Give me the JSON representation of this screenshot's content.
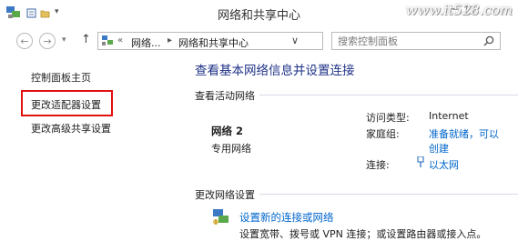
{
  "window": {
    "title": "网络和共享中心",
    "controls": [
      "─",
      "□"
    ],
    "watermark": "www.it528.com"
  },
  "navigation": {
    "breadcrumb_overflow": "«",
    "breadcrumbs": [
      "网络...",
      "网络和共享中心"
    ],
    "search_placeholder": "搜索控制面板"
  },
  "sidebar": {
    "items": [
      {
        "label": "控制面板主页"
      },
      {
        "label": "更改适配器设置",
        "highlighted": true
      },
      {
        "label": "更改高级共享设置"
      }
    ]
  },
  "main": {
    "title": "查看基本网络信息并设置连接",
    "active_networks_header": "查看活动网络",
    "network": {
      "name": "网络  2",
      "type": "专用网络"
    },
    "properties": {
      "access_type_label": "访问类型:",
      "access_type_value": "Internet",
      "homegroup_label": "家庭组:",
      "homegroup_value_line1": "准备就绪，可以",
      "homegroup_value_line2": "创建",
      "connections_label": "连接:",
      "connections_value": "以太网"
    },
    "change_settings_header": "更改网络设置",
    "setup_link": "设置新的连接或网络",
    "setup_desc": "设置宽带、拨号或 VPN 连接；或设置路由器或接入点。"
  },
  "colors": {
    "link": "#0066cc",
    "title": "#1e3287",
    "highlight": "#e01010"
  }
}
